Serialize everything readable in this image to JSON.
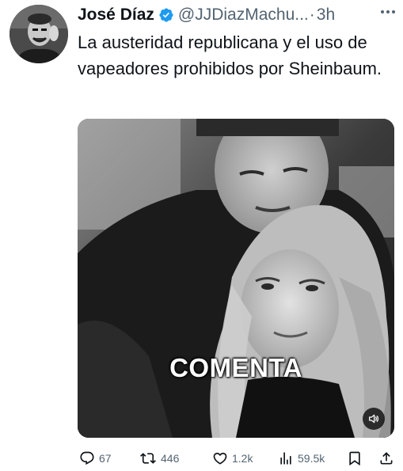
{
  "tweet": {
    "display_name": "José Díaz",
    "handle": "@JJDiazMachu...",
    "separator": "·",
    "time": "3h",
    "text": "La austeridad republicana y el uso de vapeadores prohibidos por Sheinbaum.",
    "media_caption": "COMENTA"
  },
  "stats": {
    "replies": "67",
    "retweets": "446",
    "likes": "1.2k",
    "views": "59.5k"
  },
  "colors": {
    "verified": "#1d9bf0",
    "secondary_text": "#536471",
    "primary_text": "#0f1419"
  },
  "icons": {
    "verified": "verified-badge-icon",
    "more": "more-icon",
    "sound": "sound-icon",
    "reply": "reply-icon",
    "retweet": "retweet-icon",
    "like": "heart-icon",
    "views": "views-icon",
    "bookmark": "bookmark-icon",
    "share": "share-icon"
  }
}
